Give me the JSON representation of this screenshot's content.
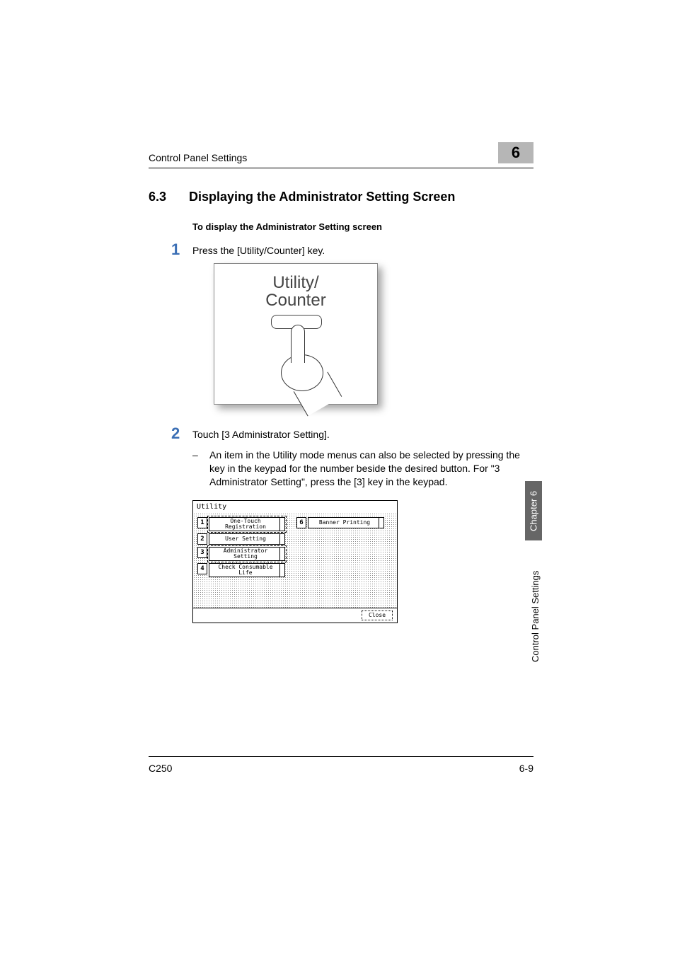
{
  "header": {
    "running_title": "Control Panel Settings",
    "chapter_number": "6"
  },
  "section": {
    "number": "6.3",
    "title": "Displaying the Administrator Setting Screen"
  },
  "sub_heading": "To display the Administrator Setting screen",
  "steps": [
    {
      "num": "1",
      "text": "Press the [Utility/Counter] key."
    },
    {
      "num": "2",
      "text": "Touch [3 Administrator Setting]."
    }
  ],
  "bullet": {
    "dash": "–",
    "text": "An item in the Utility mode menus can also be selected by pressing the key in the keypad for the number beside the desired button. For \"3 Administrator Setting\", press the [3] key in the keypad."
  },
  "figure1": {
    "label": "Utility/\nCounter"
  },
  "figure2": {
    "title": "Utility",
    "left_items": [
      {
        "num": "1",
        "label": "One-Touch\nRegistration",
        "highlighted": true
      },
      {
        "num": "2",
        "label": "User Setting",
        "highlighted": false
      },
      {
        "num": "3",
        "label": "Administrator\nSetting",
        "highlighted": true
      },
      {
        "num": "4",
        "label": "Check Consumable\nLife",
        "highlighted": false
      }
    ],
    "right_items": [
      {
        "num": "6",
        "label": "Banner Printing",
        "highlighted": false
      }
    ],
    "close": "Close"
  },
  "side_tab": {
    "dark": "Chapter 6",
    "light": "Control Panel Settings"
  },
  "footer": {
    "left": "C250",
    "right": "6-9"
  }
}
